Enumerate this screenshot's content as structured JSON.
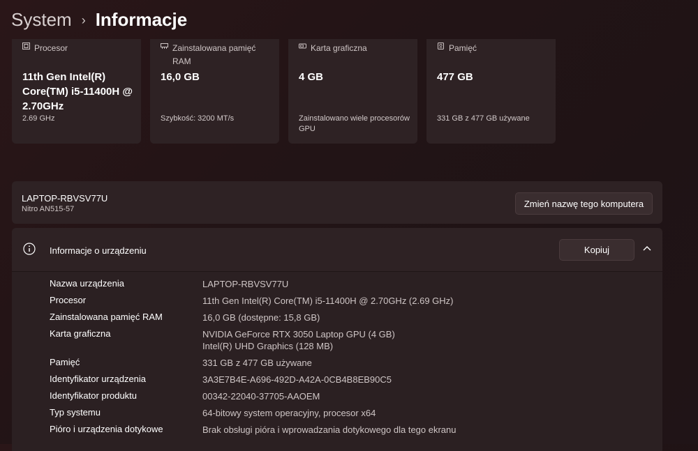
{
  "breadcrumb": {
    "parent": "System",
    "separator": "›",
    "current": "Informacje"
  },
  "spec_cards": [
    {
      "icon": "processor-icon",
      "label": "Procesor",
      "value": "11th Gen Intel(R) Core(TM) i5-11400H @ 2.70GHz",
      "sub": "2.69 GHz"
    },
    {
      "icon": "ram-icon",
      "label": "Zainstalowana pamięć RAM",
      "value": "16,0 GB",
      "sub": "Szybkość: 3200 MT/s"
    },
    {
      "icon": "graphics-card-icon",
      "label": "Karta graficzna",
      "value": "4 GB",
      "sub": "Zainstalowano wiele procesorów GPU"
    },
    {
      "icon": "storage-icon",
      "label": "Pamięć",
      "value": "477 GB",
      "sub": "331 GB z 477 GB używane"
    }
  ],
  "computer": {
    "name": "LAPTOP-RBVSV77U",
    "model": "Nitro AN515-57",
    "rename_button": "Zmień nazwę tego komputera"
  },
  "device_info": {
    "title": "Informacje o urządzeniu",
    "copy_button": "Kopiuj",
    "rows": [
      {
        "key": "Nazwa urządzenia",
        "values": [
          "LAPTOP-RBVSV77U"
        ]
      },
      {
        "key": "Procesor",
        "values": [
          "11th Gen Intel(R) Core(TM) i5-11400H @ 2.70GHz (2.69 GHz)"
        ]
      },
      {
        "key": "Zainstalowana pamięć RAM",
        "values": [
          "16,0 GB (dostępne: 15,8 GB)"
        ]
      },
      {
        "key": "Karta graficzna",
        "values": [
          "NVIDIA GeForce RTX 3050 Laptop GPU (4 GB)",
          "Intel(R) UHD Graphics (128 MB)"
        ]
      },
      {
        "key": "Pamięć",
        "values": [
          "331 GB z 477 GB używane"
        ]
      },
      {
        "key": "Identyfikator urządzenia",
        "values": [
          "3A3E7B4E-A696-492D-A42A-0CB4B8EB90C5"
        ]
      },
      {
        "key": "Identyfikator produktu",
        "values": [
          "00342-22040-37705-AAOEM"
        ]
      },
      {
        "key": "Typ systemu",
        "values": [
          "64-bitowy system operacyjny, procesor x64"
        ]
      },
      {
        "key": "Pióro i urządzenia dotykowe",
        "values": [
          "Brak obsługi pióra i wprowadzania dotykowego dla tego ekranu"
        ]
      }
    ]
  },
  "colors": {
    "background": "#231416",
    "card": "#2e2224",
    "text": "#ffffff",
    "secondary_text": "#cfc6c6"
  }
}
